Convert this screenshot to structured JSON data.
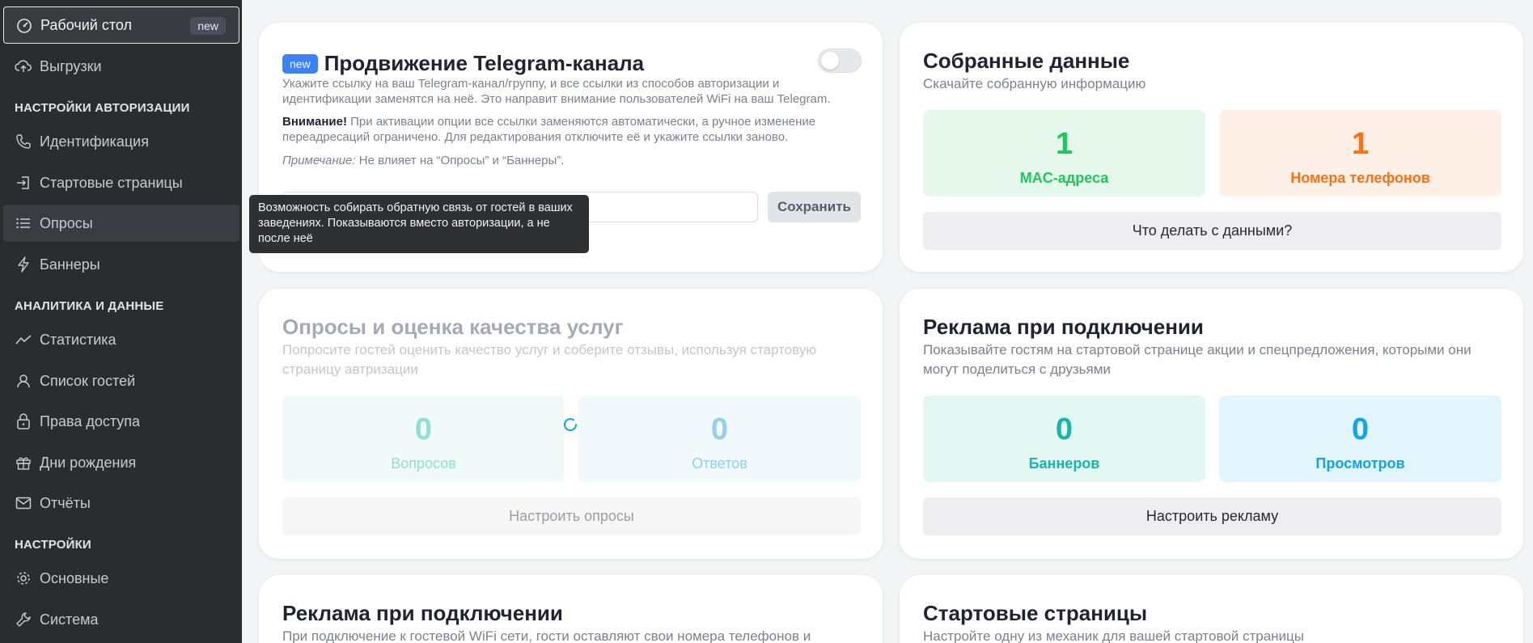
{
  "sidebar": {
    "dashboard": {
      "label": "Рабочий стол",
      "badge": "new"
    },
    "uploads": "Выгрузки",
    "section_auth": "НАСТРОЙКИ АВТОРИЗАЦИИ",
    "identification": "Идентификация",
    "start_pages": "Стартовые страницы",
    "surveys": "Опросы",
    "banners": "Баннеры",
    "section_analytics": "АНАЛИТИКА И ДАННЫЕ",
    "statistics": "Статистика",
    "guest_list": "Список гостей",
    "access_rights": "Права доступа",
    "birthdays": "Дни рождения",
    "reports": "Отчёты",
    "section_settings": "НАСТРОЙКИ",
    "general": "Основные",
    "system": "Система"
  },
  "telegram": {
    "badge": "new",
    "title": "Продвижение Telegram-канала",
    "desc": "Укажите ссылку на ваш Telegram-канал/группу, и все ссылки из способов авторизации и идентификации заменятся на неё. Это направит внимание пользователей WiFi на ваш Telegram.",
    "warning_label": "Внимание!",
    "warning_text": " При активации опции все ссылки заменяются автоматически, а ручное изменение переадресаций ограничено. Для редактирования отключите её и укажите ссылки заново.",
    "note_label": "Примечание:",
    "note_text": " Не влияет на “Опросы” и “Баннеры”.",
    "save_label": "Сохранить",
    "toggle_on": false
  },
  "tooltip": "Возможность собирать обратную связь от гостей в ваших заведениях. Показываются вместо авторизации, а не после неё",
  "collected": {
    "title": "Собранные данные",
    "subtitle": "Скачайте собранную информацию",
    "mac_value": "1",
    "mac_label": "MAC-адреса",
    "phones_value": "1",
    "phones_label": "Номера телефонов",
    "action": "Что делать с данными?"
  },
  "surveys_card": {
    "title": "Опросы и оценка качества услуг",
    "subtitle": "Попросите гостей оценить качество услуг и соберите отзывы, используя стартовую страницу автризации",
    "questions_value": "0",
    "questions_label": "Вопросов",
    "answers_value": "0",
    "answers_label": "Ответов",
    "action": "Настроить опросы"
  },
  "ads_card": {
    "title": "Реклама при подключении",
    "subtitle": "Показывайте гостям на стартовой странице акции и спецпредложения, которыми они могут поделиться с друзьями",
    "banners_value": "0",
    "banners_label": "Баннеров",
    "views_value": "0",
    "views_label": "Просмотров",
    "action": "Настроить рекламу"
  },
  "bottom_left": {
    "title": "Реклама при подключении",
    "subtitle": "При подключение к гостевой WiFi сети, гости оставляют свои номера телефонов и"
  },
  "bottom_right": {
    "title": "Стартовые страницы",
    "subtitle": "Настройте одну из механик для вашей стартовой страницы"
  },
  "colors": {
    "sidebar_bg": "#2b2c30",
    "green": "#22c55e",
    "orange": "#f97316",
    "teal": "#14b8a6",
    "sky": "#0ea5e9",
    "new_badge": "#3b82f6"
  }
}
